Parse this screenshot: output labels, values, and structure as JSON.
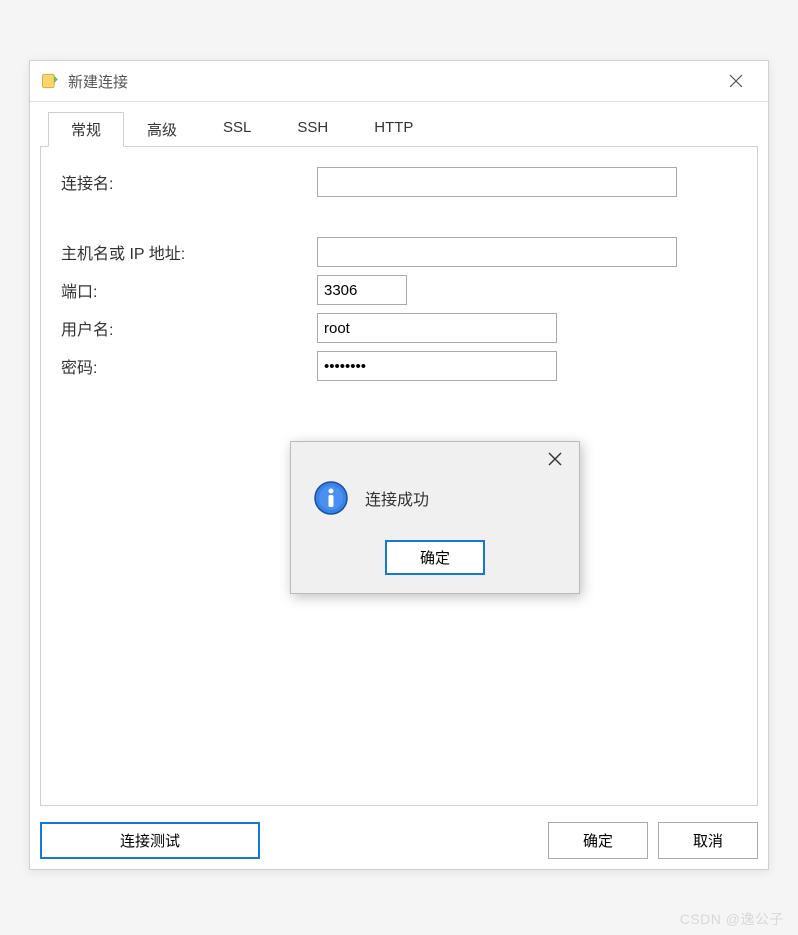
{
  "window": {
    "title": "新建连接"
  },
  "tabs": [
    {
      "label": "常规",
      "active": true
    },
    {
      "label": "高级",
      "active": false
    },
    {
      "label": "SSL",
      "active": false
    },
    {
      "label": "SSH",
      "active": false
    },
    {
      "label": "HTTP",
      "active": false
    }
  ],
  "form": {
    "connection_name": {
      "label": "连接名:",
      "value": ""
    },
    "host": {
      "label": "主机名或 IP 地址:",
      "value": ""
    },
    "port": {
      "label": "端口:",
      "value": "3306"
    },
    "username": {
      "label": "用户名:",
      "value": "root"
    },
    "password": {
      "label": "密码:",
      "value": "••••••••"
    }
  },
  "footer": {
    "test_connection": "连接测试",
    "ok": "确定",
    "cancel": "取消"
  },
  "modal": {
    "message": "连接成功",
    "ok": "确定"
  },
  "watermark": "CSDN @逸公子"
}
